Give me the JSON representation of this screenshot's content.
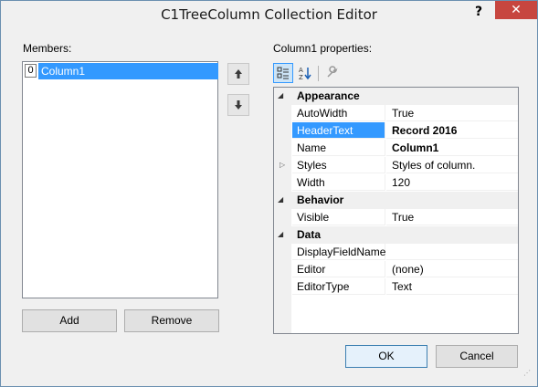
{
  "window": {
    "title": "C1TreeColumn Collection Editor",
    "help_label": "?",
    "close_label": "✕"
  },
  "members": {
    "label": "Members:",
    "items": [
      {
        "index": "0",
        "name": "Column1"
      }
    ],
    "add_label": "Add",
    "remove_label": "Remove",
    "move_up_icon": "arrow-up-icon",
    "move_down_icon": "arrow-down-icon"
  },
  "properties": {
    "label": "Column1 properties:",
    "toolbar": {
      "categorized_icon": "categorized-icon",
      "alphabetical_icon": "alphabetical-icon",
      "property_pages_icon": "wrench-icon"
    },
    "categories": [
      {
        "name": "Appearance",
        "rows": [
          {
            "name": "AutoWidth",
            "value": "True"
          },
          {
            "name": "HeaderText",
            "value": "Record 2016",
            "selected": true,
            "bold": true
          },
          {
            "name": "Name",
            "value": "Column1",
            "bold": true
          },
          {
            "name": "Styles",
            "value": "Styles of column.",
            "expandable": true
          },
          {
            "name": "Width",
            "value": "120"
          }
        ]
      },
      {
        "name": "Behavior",
        "rows": [
          {
            "name": "Visible",
            "value": "True"
          }
        ]
      },
      {
        "name": "Data",
        "rows": [
          {
            "name": "DisplayFieldName",
            "value": ""
          },
          {
            "name": "Editor",
            "value": "(none)"
          },
          {
            "name": "EditorType",
            "value": "Text"
          }
        ]
      }
    ]
  },
  "footer": {
    "ok_label": "OK",
    "cancel_label": "Cancel"
  },
  "colors": {
    "selection": "#3399ff",
    "close_button": "#c7463f"
  }
}
